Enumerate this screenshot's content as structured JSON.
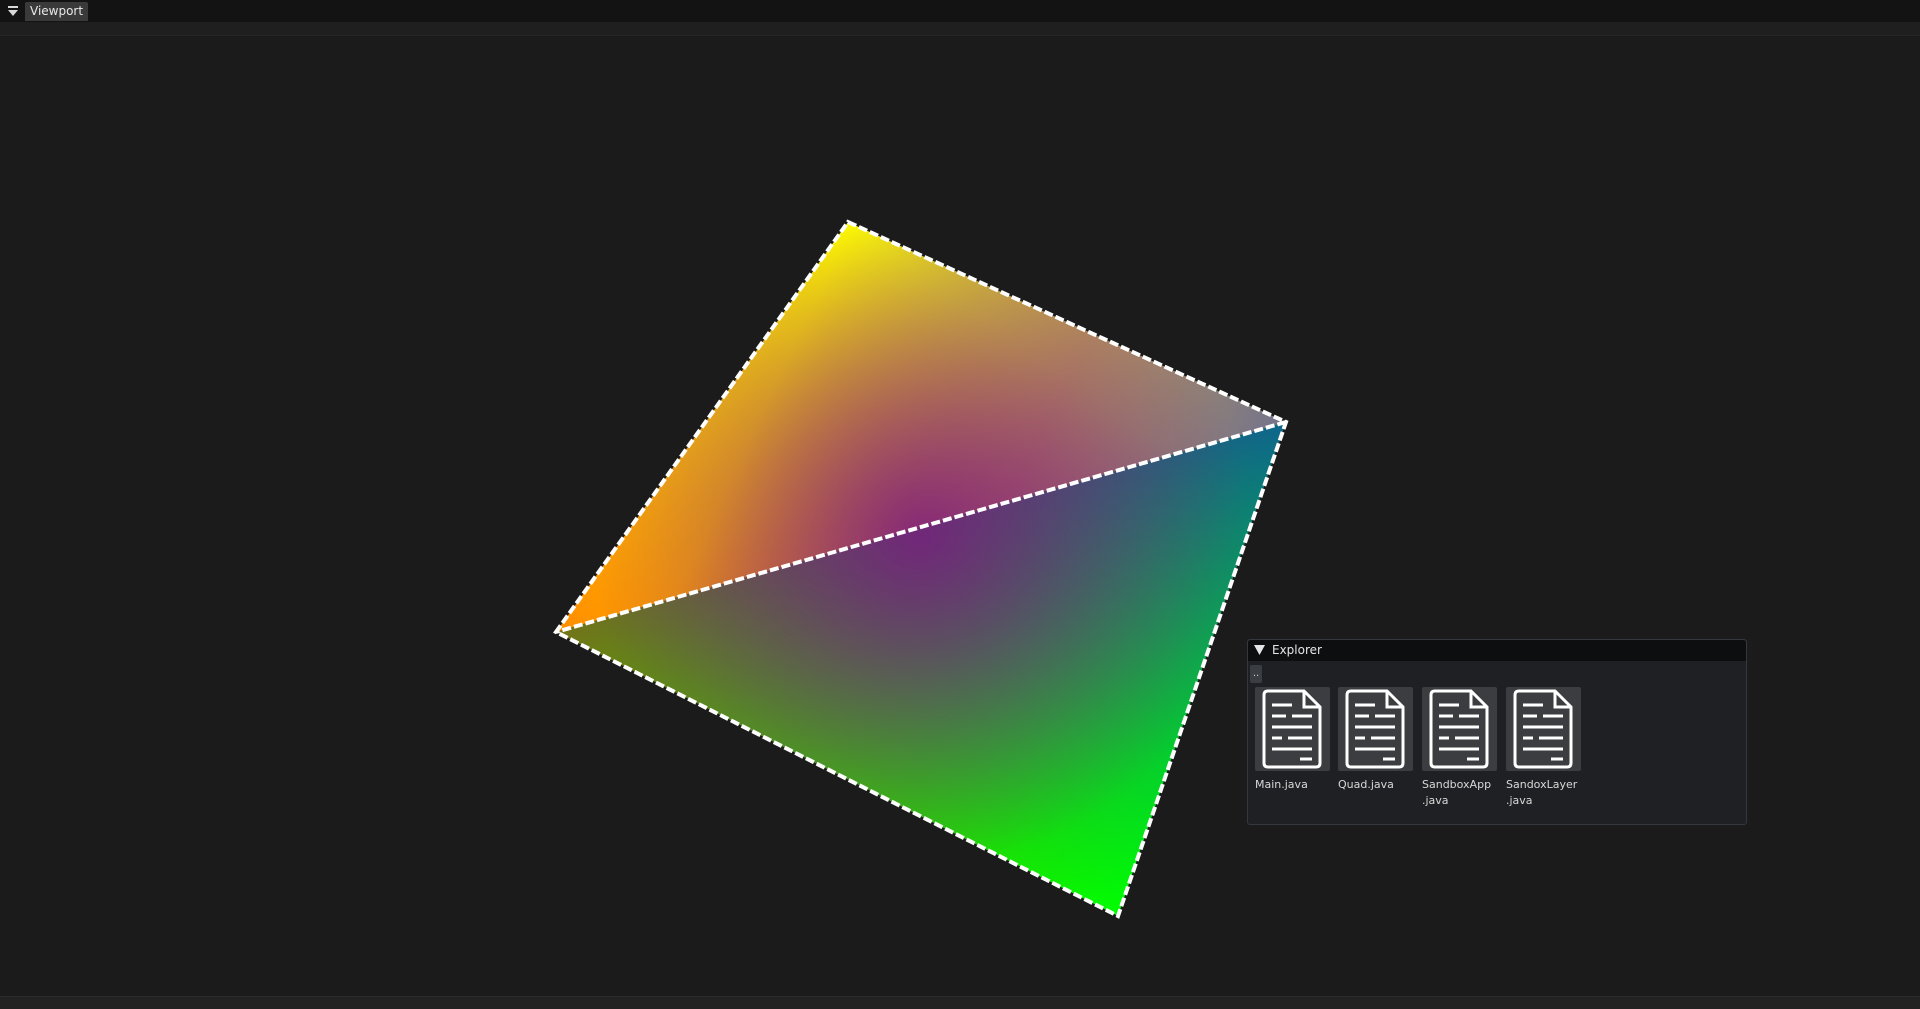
{
  "tabbar": {
    "menu_icon": "dropdown-triangle-icon",
    "active_tab": "Viewport"
  },
  "viewport": {
    "vertex_colors": {
      "top": "#ffff00",
      "right": "#0000ff",
      "bottom": "#00ff00",
      "left": "#ff0000"
    },
    "wireframe_color": "#ffffff"
  },
  "explorer": {
    "title": "Explorer",
    "up_label": "..",
    "files": [
      {
        "name": "Main.java",
        "icon": "document-icon"
      },
      {
        "name": "Quad.java",
        "icon": "document-icon"
      },
      {
        "name": "SandboxApp\n.java",
        "icon": "document-icon"
      },
      {
        "name": "SandoxLayer\n.java",
        "icon": "document-icon"
      }
    ]
  }
}
